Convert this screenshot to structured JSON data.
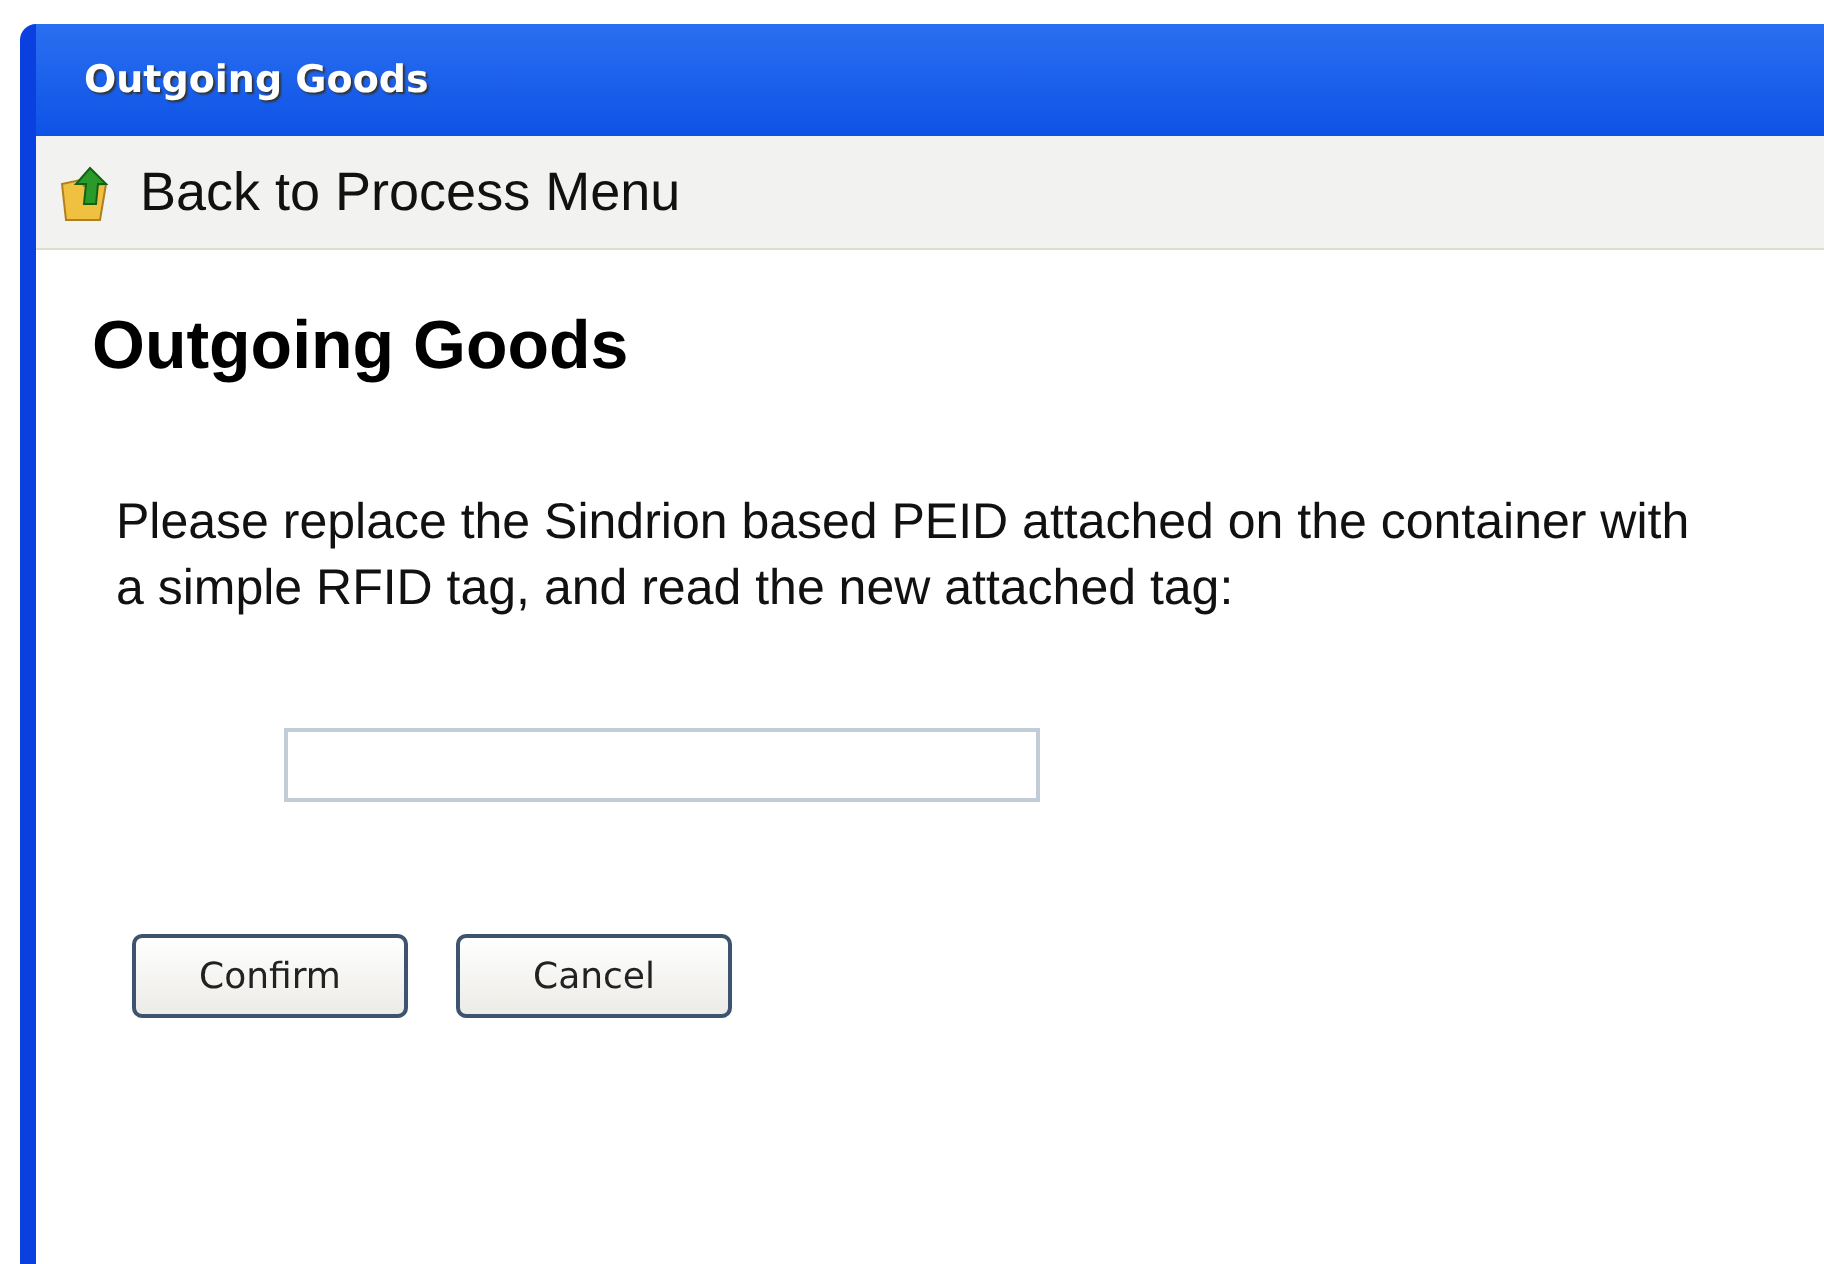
{
  "window": {
    "title": "Outgoing Goods"
  },
  "toolbar": {
    "back_link": "Back to Process Menu"
  },
  "heading": "Outgoing Goods",
  "instruction": "Please replace the Sindrion based PEID attached on the container with a simple RFID tag, and read the new attached tag:",
  "buttons": [
    "Confirm",
    "Cancel"
  ]
}
